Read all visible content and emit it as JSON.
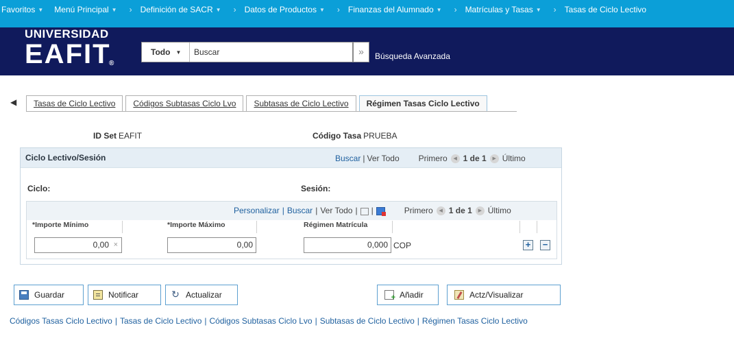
{
  "topnav": {
    "items": [
      "Favoritos",
      "Menú Principal",
      "Definición de SACR",
      "Datos de Productos",
      "Finanzas del Alumnado",
      "Matrículas y Tasas",
      "Tasas de Ciclo Lectivo"
    ]
  },
  "header": {
    "logo_line1": "UNIVERSIDAD",
    "logo_line2": "EAFIT",
    "logo_reg": "®",
    "search_scope": "Todo",
    "search_placeholder": "Buscar",
    "search_go": "»",
    "advanced_search": "Búsqueda Avanzada"
  },
  "tabs": [
    {
      "label": "Tasas de Ciclo Lectivo",
      "active": false
    },
    {
      "label": "Códigos Subtasas Ciclo Lvo",
      "active": false
    },
    {
      "label": "Subtasas de Ciclo Lectivo",
      "active": false
    },
    {
      "label": "Régimen Tasas Ciclo Lectivo",
      "active": true
    }
  ],
  "keys": {
    "setid_label": "ID Set",
    "setid_value": "EAFIT",
    "code_label": "Código Tasa",
    "code_value": "PRUEBA"
  },
  "grid": {
    "title": "Ciclo Lectivo/Sesión",
    "find": "Buscar",
    "view_all": "Ver Todo",
    "first": "Primero",
    "count": "1 de 1",
    "last": "Último",
    "ciclo_label": "Ciclo:",
    "sesion_label": "Sesión:"
  },
  "subgrid": {
    "personalize": "Personalizar",
    "find": "Buscar",
    "view_all": "Ver Todo",
    "first": "Primero",
    "count": "1 de 1",
    "last": "Último",
    "columns": [
      "*Importe Mínimo",
      "*Importe Máximo",
      "Régimen Matrícula"
    ],
    "row": {
      "min": "0,00",
      "max": "0,00",
      "rate": "0,000",
      "currency": "COP"
    }
  },
  "buttons": {
    "save": "Guardar",
    "notify": "Notificar",
    "refresh": "Actualizar",
    "add": "Añadir",
    "update": "Actz/Visualizar"
  },
  "bottom_links": [
    "Códigos Tasas Ciclo Lectivo",
    "Tasas de Ciclo Lectivo",
    "Códigos Subtasas Ciclo Lvo",
    "Subtasas de Ciclo Lectivo",
    "Régimen Tasas Ciclo Lectivo"
  ]
}
